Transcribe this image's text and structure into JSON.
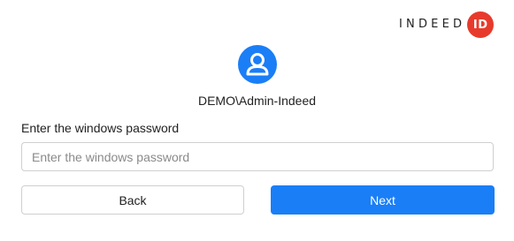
{
  "brand": {
    "wordmark": "INDEED",
    "badge": "ID",
    "badge_color": "#e83a2c"
  },
  "user": {
    "avatar_icon": "user-avatar-icon",
    "avatar_color": "#1a7ef7",
    "name": "DEMO\\Admin-Indeed"
  },
  "password": {
    "label": "Enter the windows password",
    "placeholder": "Enter the windows password",
    "value": ""
  },
  "actions": {
    "back_label": "Back",
    "next_label": "Next",
    "primary_color": "#1a7ef7"
  }
}
